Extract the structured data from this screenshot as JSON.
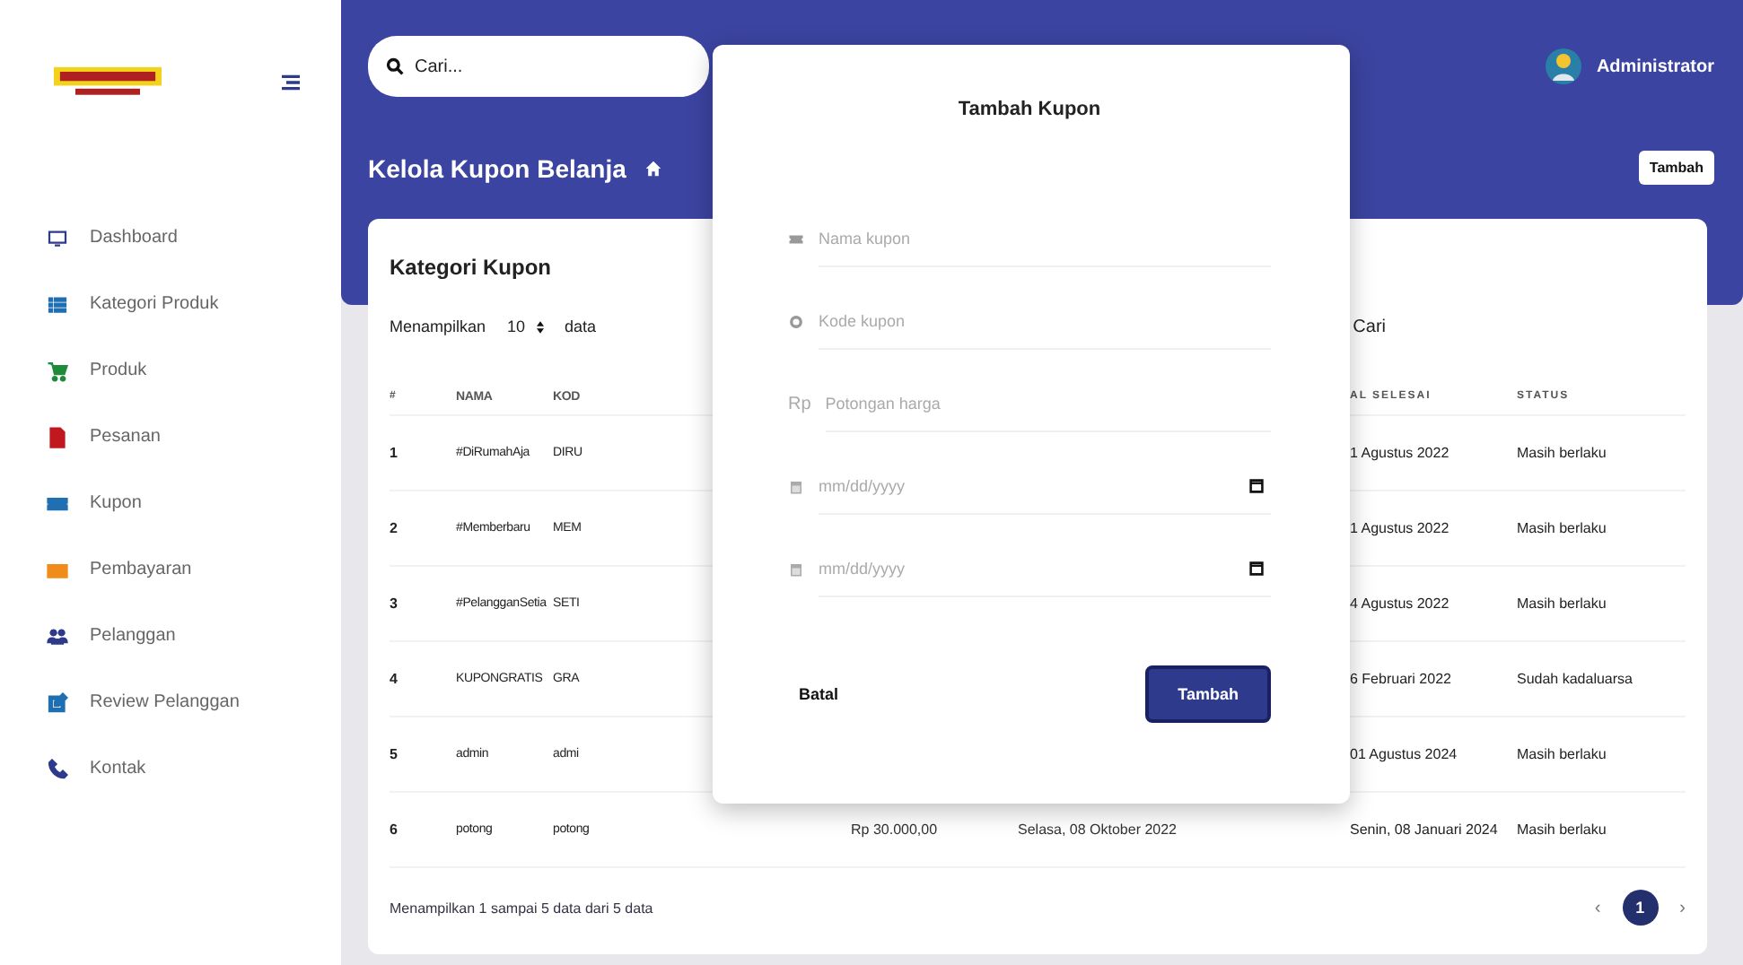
{
  "sidebar": {
    "items": [
      {
        "label": "Dashboard",
        "color": "#2e3a8c",
        "selected": false
      },
      {
        "label": "Kategori Produk",
        "color": "#1f6fb2",
        "selected": false
      },
      {
        "label": "Produk",
        "color": "#1e8a3a",
        "selected": false
      },
      {
        "label": "Pesanan",
        "color": "#c0181e",
        "selected": false
      },
      {
        "label": "Kupon",
        "color": "#1f6fb2",
        "selected": false
      },
      {
        "label": "Pembayaran",
        "color": "#f08c1a",
        "selected": false
      },
      {
        "label": "Pelanggan",
        "color": "#2e3a8c",
        "selected": false
      },
      {
        "label": "Review Pelanggan",
        "color": "#1f6fb2",
        "selected": false
      },
      {
        "label": "Kontak",
        "color": "#2e3a8c",
        "selected": false
      }
    ]
  },
  "topbar": {
    "search": {
      "placeholder": "Cari..."
    },
    "user": "Administrator"
  },
  "page_header": {
    "title": "Kelola Kupon Belanja",
    "add_button": "Tambah"
  },
  "card": {
    "title": "Kategori Kupon",
    "length": {
      "before": "Menampilkan",
      "value": "10",
      "after": "data"
    },
    "search_label": "Cari",
    "table": {
      "columns": [
        "#",
        "NAMA",
        "KOD",
        "AL SELESAI",
        "STATUS"
      ],
      "rows": [
        {
          "no": "1",
          "nama": "#DiRumahAja",
          "kode": "DIRU",
          "selesai": "1 Agustus 2022",
          "status": "Masih berlaku"
        },
        {
          "no": "2",
          "nama": "#Memberbaru",
          "kode": "MEM",
          "selesai": "1 Agustus 2022",
          "status": "Masih berlaku"
        },
        {
          "no": "3",
          "nama": "#PelangganSetia",
          "kode": "SETI",
          "selesai": "4 Agustus 2022",
          "status": "Masih berlaku"
        },
        {
          "no": "4",
          "nama": "KUPONGRATIS",
          "kode": "GRA",
          "selesai": "6 Februari 2022",
          "status": "Sudah kadaluarsa"
        },
        {
          "no": "5",
          "nama": "admin",
          "kode": "admi",
          "selesai": "01 Agustus 2024",
          "status": "Masih berlaku"
        },
        {
          "no": "6",
          "nama": "potong",
          "kode": "potong",
          "nominal": "Rp 30.000,00",
          "mulai": "Selasa, 08 Oktober 2022",
          "selesai": "Senin, 08 Januari 2024",
          "status": "Masih berlaku"
        }
      ]
    },
    "info": "Menampilkan 1 sampai 5 data dari 5 data",
    "pagination": {
      "prev": "‹",
      "pages": [
        {
          "label": "1",
          "selected": true
        }
      ],
      "next": "›"
    }
  },
  "modal": {
    "title": "Tambah Kupon",
    "fields": [
      {
        "kind": "name",
        "placeholder": "Nama kupon"
      },
      {
        "kind": "code",
        "placeholder": "Kode kupon"
      },
      {
        "kind": "money",
        "prefix": "Rp",
        "placeholder": "Potongan harga"
      },
      {
        "kind": "date",
        "placeholder": "mm/dd/yyyy"
      },
      {
        "kind": "date",
        "placeholder": "mm/dd/yyyy"
      }
    ],
    "cancel": "Batal",
    "submit": "Tambah"
  }
}
